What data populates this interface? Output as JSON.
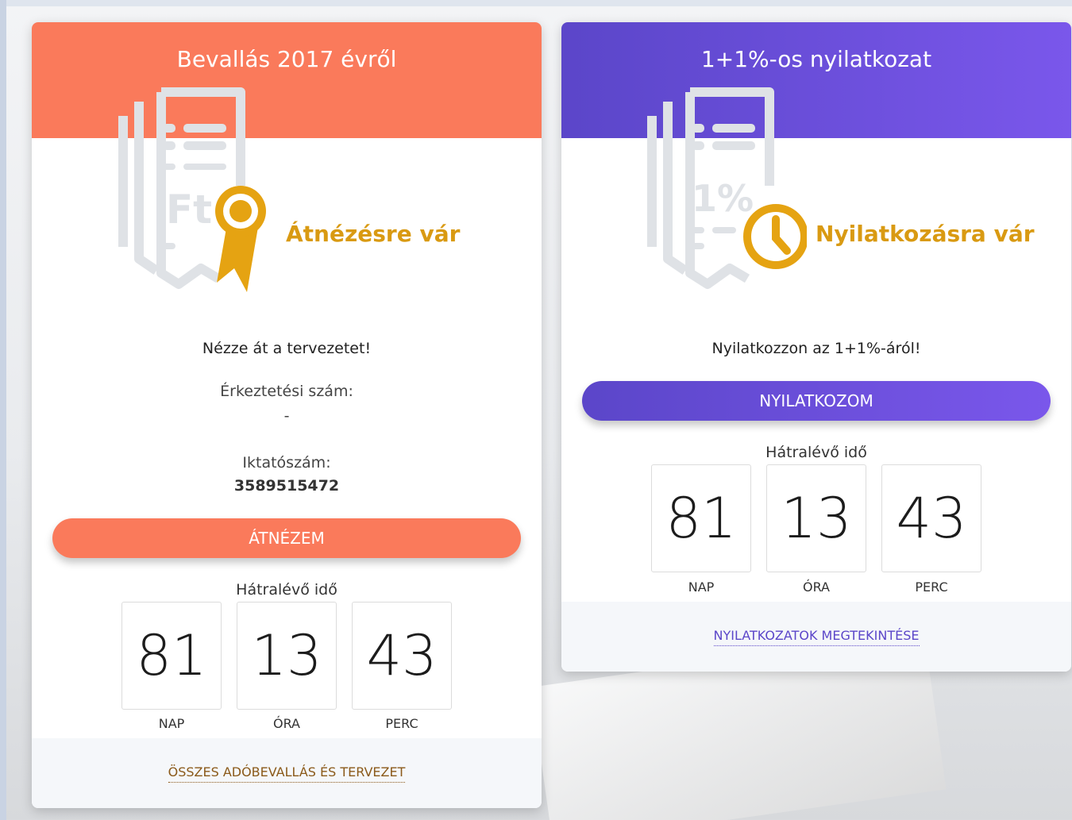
{
  "cards": [
    {
      "title": "Bevallás 2017 évről",
      "status": "Átnézésre vár",
      "message": "Nézze át a tervezetet!",
      "reg_label": "Érkeztetési szám:",
      "reg_value": "-",
      "id_label": "Iktatószám:",
      "id_value": "3589515472",
      "button_label": "ÁTNÉZEM",
      "countdown_label": "Hátralévő idő",
      "countdown": {
        "days": "81",
        "hours": "13",
        "minutes": "43"
      },
      "units": {
        "days": "NAP",
        "hours": "ÓRA",
        "minutes": "PERC"
      },
      "footer_link": "ÖSSZES ADÓBEVALLÁS ÉS TERVEZET",
      "icon": "tax-document-ribbon-icon",
      "accent": "#fa7a5b"
    },
    {
      "title": "1+1%-os nyilatkozat",
      "status": "Nyilatkozásra vár",
      "message": "Nyilatkozzon az 1+1%-áról!",
      "button_label": "NYILATKOZOM",
      "countdown_label": "Hátralévő idő",
      "countdown": {
        "days": "81",
        "hours": "13",
        "minutes": "43"
      },
      "units": {
        "days": "NAP",
        "hours": "ÓRA",
        "minutes": "PERC"
      },
      "footer_link": "NYILATKOZATOK MEGTEKINTÉSE",
      "icon": "percent-document-clock-icon",
      "accent": "#6a4fdc"
    }
  ],
  "status_color": "#d99a12"
}
